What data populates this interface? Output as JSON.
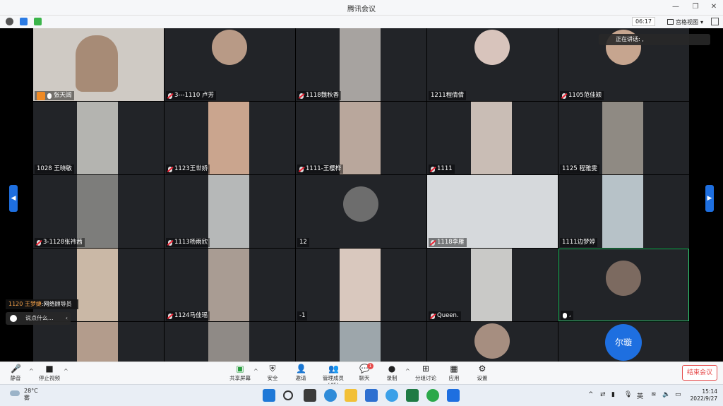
{
  "window": {
    "title": "腾讯会议",
    "timer": "06:17",
    "view_label": "宫格视图"
  },
  "speaking": {
    "label": "正在讲话: ,"
  },
  "tiles": [
    {
      "name": "张天阔",
      "mic": "active",
      "host": true
    },
    {
      "name": "3---1110  卢芳",
      "mic": "muted"
    },
    {
      "name": "1118魏秋香",
      "mic": "muted"
    },
    {
      "name": "1211程倩倩",
      "mic": "none"
    },
    {
      "name": "1105范佳颖",
      "mic": "muted"
    },
    {
      "name": "1028 王晓敏",
      "mic": "none"
    },
    {
      "name": "1123王世娇",
      "mic": "muted"
    },
    {
      "name": "1111-王樱桦",
      "mic": "muted"
    },
    {
      "name": "1111",
      "mic": "muted"
    },
    {
      "name": "1125  程雅雯",
      "mic": "none"
    },
    {
      "name": "3-1128张祎茜",
      "mic": "muted"
    },
    {
      "name": "1113杨雨欣",
      "mic": "muted"
    },
    {
      "name": "12",
      "mic": "none"
    },
    {
      "name": "1118李雁",
      "mic": "muted"
    },
    {
      "name": "1111边梦婷",
      "mic": "none"
    },
    {
      "name": "1120 王梦婕",
      "mic": "none"
    },
    {
      "name": "1124马佳瑶",
      "mic": "muted"
    },
    {
      "name": "-1",
      "mic": "none"
    },
    {
      "name": "Queen.",
      "mic": "muted"
    },
    {
      "name": ",",
      "mic": "active"
    },
    {
      "name": "",
      "mic": "none"
    },
    {
      "name": "",
      "mic": "none"
    },
    {
      "name": "",
      "mic": "none"
    },
    {
      "name": "",
      "mic": "none"
    },
    {
      "name": "",
      "mic": "none"
    }
  ],
  "avatar_text": "尔璇",
  "chat": {
    "sender": "1120 王梦婕",
    "message": ":网络顾导员",
    "input_placeholder": "说点什么..."
  },
  "toolbar": {
    "mute": "静音",
    "stop_video": "停止视频",
    "share": "共享屏幕",
    "security": "安全",
    "invite": "邀请",
    "members": "管理成员(45)",
    "chat": "聊天",
    "chat_badge": "1",
    "record": "录制",
    "breakout": "分组讨论",
    "apps": "应用",
    "settings": "设置",
    "end": "结束会议"
  },
  "taskbar": {
    "temperature": "28°C",
    "weather": "雾",
    "ime": "英",
    "time": "15:14",
    "date": "2022/9/27"
  },
  "colors": {
    "accent": "#1e6fe0",
    "end": "#e64b4b",
    "speaker_border": "#2ecc71",
    "host": "#f08a24"
  }
}
